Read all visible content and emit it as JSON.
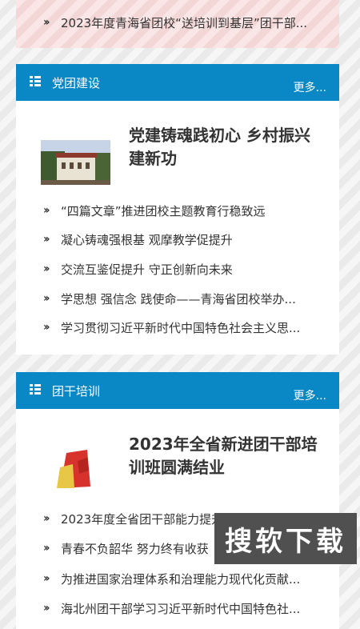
{
  "top_news": {
    "item": "2023年度青海省团校“送培训到基层”团干部..."
  },
  "sections": [
    {
      "title": "党团建设",
      "more": "更多...",
      "headline": "党建铸魂践初心 乡村振兴建新功",
      "items": [
        "“四篇文章”推进团校主题教育行稳致远",
        "凝心铸魂强根基 观摩教学促提升",
        "交流互鉴促提升 守正创新向未来",
        "学思想 强信念 践使命——青海省团校举办...",
        "学习贯彻习近平新时代中国特色社会主义思..."
      ]
    },
    {
      "title": "团干培训",
      "more": "更多...",
      "headline": "2023年全省新进团干部培训班圆满结业",
      "items": [
        "2023年度全省团干部能力提升培训班...",
        "青春不负韶华 努力终有收获",
        "为推进国家治理体系和治理能力现代化贡献...",
        "海北州团干部学习习近平新时代中国特色社..."
      ]
    }
  ],
  "watermark": "搜软下载",
  "icons": {
    "list": "list-icon",
    "bullet": "double-chevron-icon"
  },
  "colors": {
    "header": "#0a88c6",
    "top_card": "#f8dede"
  }
}
